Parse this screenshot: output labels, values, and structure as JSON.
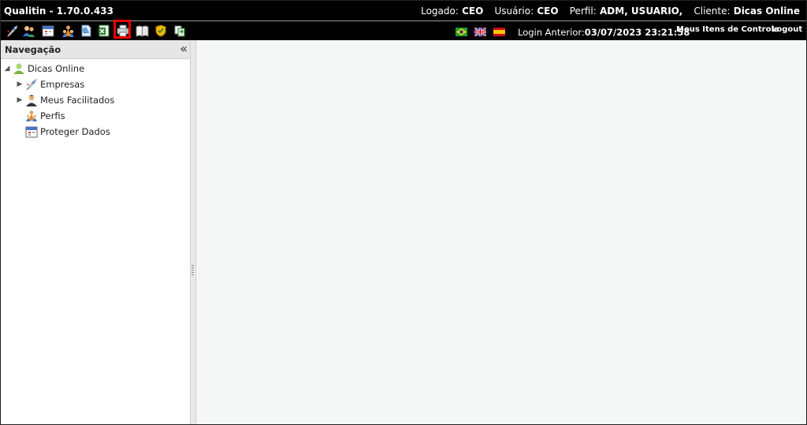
{
  "titlebar": {
    "app_title": "Qualitin - 1.70.0.433",
    "logado_label": "Logado:",
    "logado_value": "CEO",
    "usuario_label": "Usuário:",
    "usuario_value": "CEO",
    "perfil_label": "Perfil:",
    "perfil_value": "ADM, USUARIO,",
    "cliente_label": "Cliente:",
    "cliente_value": "Dicas Online"
  },
  "toolbar": {
    "icons": [
      "rocket-icon",
      "users-icon",
      "calendar-icon",
      "profiles-icon",
      "document-icon",
      "excel-icon",
      "printer-icon",
      "book-icon",
      "shield-icon",
      "refresh-icon"
    ],
    "flags": [
      "flag-brazil-icon",
      "flag-uk-icon",
      "flag-spain-icon"
    ],
    "login_label": "Login Anterior:",
    "login_value": "03/07/2023 23:21:58",
    "meus_itens": "Meus Itens de Controle",
    "logout": "Logout"
  },
  "navigation": {
    "title": "Navegação",
    "collapse_symbol": "«",
    "root": "Dicas Online",
    "items": [
      {
        "label": "Empresas",
        "expandable": true
      },
      {
        "label": "Meus Facilitados",
        "expandable": true
      },
      {
        "label": "Perfis",
        "expandable": false
      },
      {
        "label": "Proteger Dados",
        "expandable": false
      }
    ]
  },
  "colors": {
    "accent_highlight": "#e00000",
    "titlebar_bg": "#000000",
    "main_bg": "#f5f6f6"
  }
}
